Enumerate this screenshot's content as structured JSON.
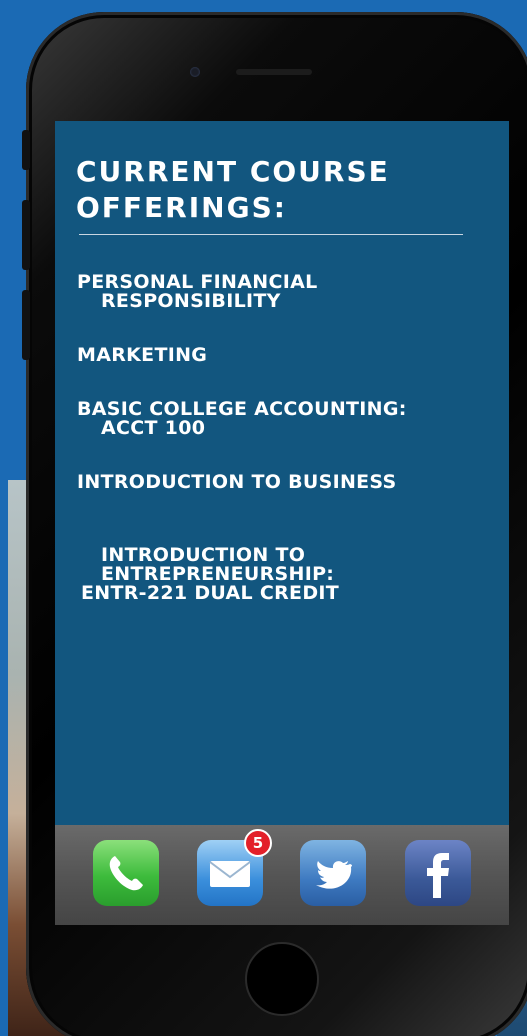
{
  "screen": {
    "title": "CURRENT COURSE\nOFFERINGS:",
    "courses": [
      {
        "label": "PERSONAL FINANCIAL\nRESPONSIBILITY"
      },
      {
        "label": "MARKETING"
      },
      {
        "label": "BASIC COLLEGE ACCOUNTING:\nACCT 100"
      },
      {
        "label": "INTRODUCTION TO BUSINESS"
      },
      {
        "label": "INTRODUCTION TO\nENTREPRENEURSHIP:",
        "label_line3": "ENTR-221 DUAL CREDIT"
      }
    ]
  },
  "dock": {
    "apps": [
      {
        "icon": "phone-icon"
      },
      {
        "icon": "mail-icon",
        "badge": "5"
      },
      {
        "icon": "twitter-icon"
      },
      {
        "icon": "facebook-icon"
      }
    ]
  },
  "colors": {
    "background": "#1b6ab4",
    "screen": "#12567f",
    "badge": "#e3202a"
  }
}
